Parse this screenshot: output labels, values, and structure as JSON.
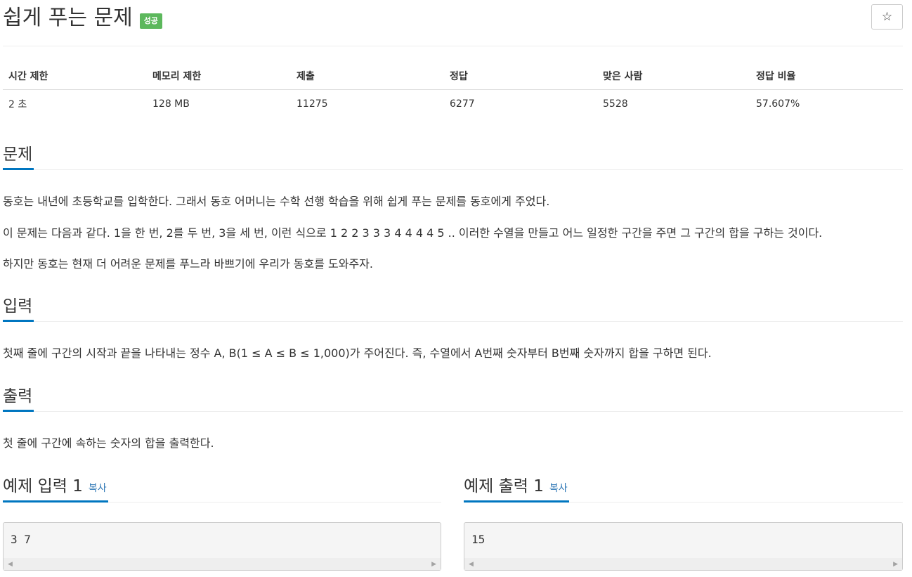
{
  "problem": {
    "title": "쉽게 푸는 문제",
    "badge": "성공",
    "star_icon": "☆"
  },
  "stats": {
    "headers": [
      "시간 제한",
      "메모리 제한",
      "제출",
      "정답",
      "맞은 사람",
      "정답 비율"
    ],
    "values": [
      "2 초",
      "128 MB",
      "11275",
      "6277",
      "5528",
      "57.607%"
    ]
  },
  "sections": {
    "problem": {
      "heading": "문제",
      "paragraphs": [
        "동호는 내년에 초등학교를 입학한다. 그래서 동호 어머니는 수학 선행 학습을 위해 쉽게 푸는 문제를 동호에게 주었다.",
        "이 문제는 다음과 같다. 1을 한 번, 2를 두 번, 3을 세 번, 이런 식으로 1 2 2 3 3 3 4 4 4 4 5 .. 이러한 수열을 만들고 어느 일정한 구간을 주면 그 구간의 합을 구하는 것이다.",
        "하지만 동호는 현재 더 어려운 문제를 푸느라 바쁘기에 우리가 동호를 도와주자."
      ]
    },
    "input": {
      "heading": "입력",
      "text": "첫째 줄에 구간의 시작과 끝을 나타내는 정수 A, B(1 ≤ A ≤ B ≤ 1,000)가 주어진다. 즉, 수열에서 A번째 숫자부터 B번째 숫자까지 합을 구하면 된다."
    },
    "output": {
      "heading": "출력",
      "text": "첫 줄에 구간에 속하는 숫자의 합을 출력한다."
    }
  },
  "samples": {
    "input": {
      "heading": "예제 입력 1",
      "copy": "복사",
      "content": "3 7"
    },
    "output": {
      "heading": "예제 출력 1",
      "copy": "복사",
      "content": "15"
    },
    "scroll_left": "◀",
    "scroll_right": "▶"
  }
}
